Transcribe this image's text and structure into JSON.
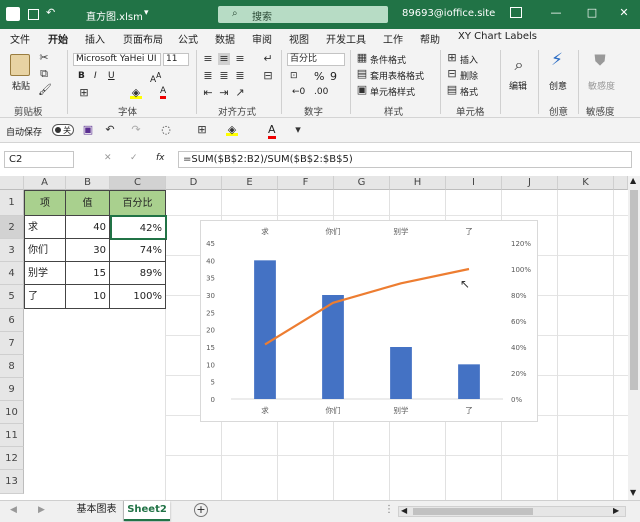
{
  "titlebar": {
    "filename": "直方图.xlsm",
    "dropdown": "▾",
    "search_placeholder": "搜索",
    "user": "89693@ioffice.site",
    "minimize": "—",
    "restore": "□",
    "close": "✕"
  },
  "menu": [
    "文件",
    "开始",
    "插入",
    "页面布局",
    "公式",
    "数据",
    "审阅",
    "视图",
    "开发工具",
    "工作",
    "帮助",
    "XY Chart Labels"
  ],
  "ribbon": {
    "paste_label": "粘贴",
    "font_name": "Microsoft YaHei UI",
    "font_size": "11",
    "number_format": "百分比",
    "cond_format": "条件格式",
    "table_format": "套用表格格式",
    "cell_style": "单元格样式",
    "insert": "插入",
    "delete": "删除",
    "format": "格式",
    "edit": "编辑",
    "create": "创意",
    "sensitivity": "敏感度",
    "groups": [
      "剪贴板",
      "字体",
      "对齐方式",
      "数字",
      "样式",
      "单元格",
      "创意",
      "敏感度"
    ]
  },
  "qat": {
    "autosave_label": "自动保存",
    "autosave_state": "关"
  },
  "formula": {
    "namebox": "C2",
    "fx": "fx",
    "value": "=SUM($B$2:B2)/SUM($B$2:$B$5)"
  },
  "grid": {
    "columns": [
      "A",
      "B",
      "C",
      "D",
      "E",
      "F",
      "G",
      "H",
      "I",
      "J",
      "K"
    ],
    "rows": [
      "1",
      "2",
      "3",
      "4",
      "5",
      "6",
      "7",
      "8",
      "9",
      "10",
      "11",
      "12",
      "13"
    ],
    "header": [
      "项",
      "值",
      "百分比"
    ],
    "data": [
      [
        "求",
        "40",
        "42%"
      ],
      [
        "你们",
        "30",
        "74%"
      ],
      [
        "别学",
        "15",
        "89%"
      ],
      [
        "了",
        "10",
        "100%"
      ]
    ]
  },
  "chart_data": {
    "type": "bar",
    "categories": [
      "求",
      "你们",
      "别学",
      "了"
    ],
    "series": [
      {
        "type": "bar",
        "values": [
          40,
          30,
          15,
          10
        ],
        "color": "#4472c4"
      },
      {
        "type": "line",
        "values": [
          0.42,
          0.74,
          0.89,
          1.0
        ],
        "color": "#ed7d31",
        "axis": "right"
      }
    ],
    "ylim": [
      0,
      45
    ],
    "y_ticks": [
      "45",
      "40",
      "35",
      "30",
      "25",
      "20",
      "15",
      "10",
      "5",
      "0"
    ],
    "y2lim": [
      0,
      1.2
    ],
    "y2_ticks": [
      "120%",
      "100%",
      "80%",
      "60%",
      "40%",
      "20%",
      "0%"
    ],
    "top_labels": [
      "求",
      "你们",
      "别学",
      "了"
    ],
    "bottom_labels": [
      "求",
      "你们",
      "别学",
      "了"
    ],
    "grid": false
  },
  "sheets": {
    "tabs": [
      "基本图表",
      "Sheet2"
    ],
    "active": "Sheet2",
    "add": "+"
  },
  "colors": {
    "excel_green": "#217346",
    "header_fill": "#a9d08e",
    "bar": "#4472c4",
    "line": "#ed7d31"
  }
}
